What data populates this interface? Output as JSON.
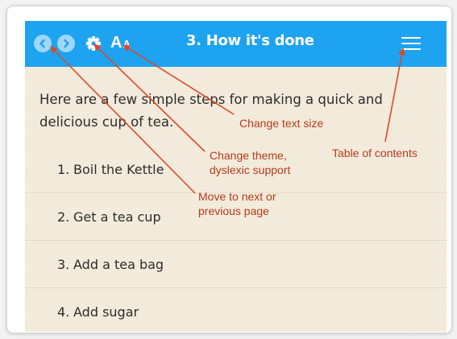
{
  "topbar": {
    "color": "#1da3f0",
    "prev_icon": "chevron-left-icon",
    "next_icon": "chevron-right-icon",
    "settings_icon": "gear-icon",
    "text_size_large": "A",
    "text_size_small": "A",
    "title": "3. How it's done",
    "toc_icon": "hamburger-menu-icon"
  },
  "content": {
    "intro": "Here are a few simple steps for making a quick and delicious cup of tea.",
    "steps": [
      {
        "num": "1.",
        "text": "Boil the Kettle"
      },
      {
        "num": "2.",
        "text": "Get a tea cup"
      },
      {
        "num": "3.",
        "text": "Add a tea bag"
      },
      {
        "num": "4.",
        "text": "Add sugar"
      }
    ]
  },
  "annotations": {
    "color": "#b63a1d",
    "text_size": "Change text size",
    "theme_line1": "Change theme,",
    "theme_line2": "dyslexic support",
    "toc": "Table of contents",
    "nav_line1": "Move to next or",
    "nav_line2": "previous page"
  }
}
